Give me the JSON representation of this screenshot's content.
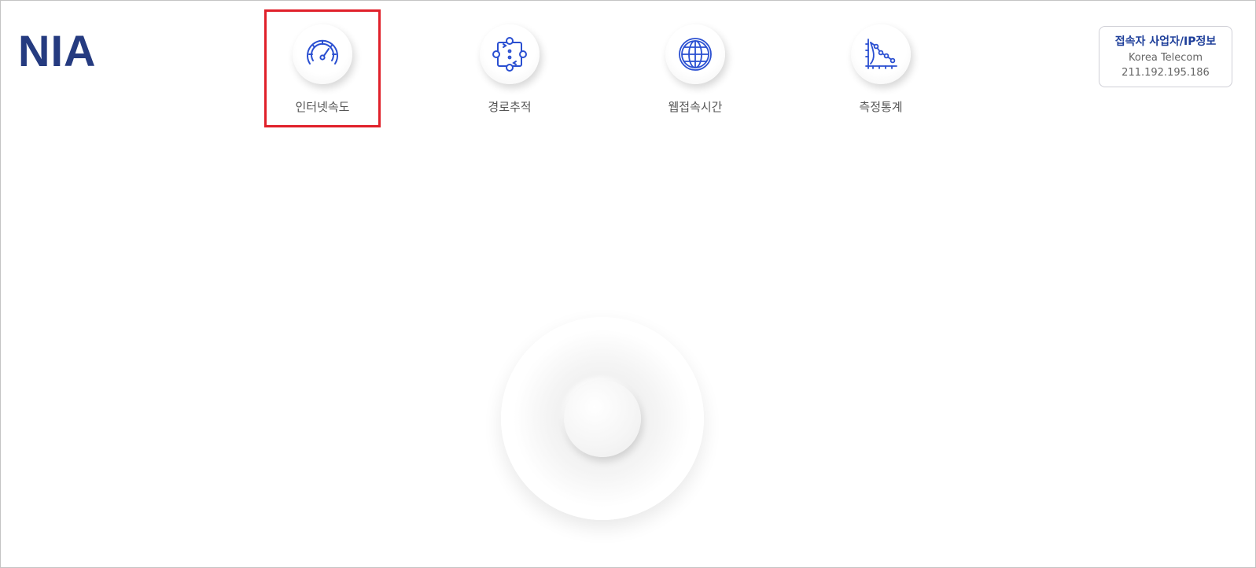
{
  "logo": {
    "text": "NIA"
  },
  "nav": {
    "items": [
      {
        "label": "인터넷속도",
        "icon": "speedometer-icon",
        "selected": true
      },
      {
        "label": "경로추적",
        "icon": "route-trace-icon",
        "selected": false
      },
      {
        "label": "웹접속시간",
        "icon": "globe-icon",
        "selected": false
      },
      {
        "label": "측정통계",
        "icon": "statistics-chart-icon",
        "selected": false
      }
    ]
  },
  "connection_info": {
    "title": "접속자 사업자/IP정보",
    "isp": "Korea Telecom",
    "ip": "211.192.195.186"
  },
  "colors": {
    "brand": "#253b80",
    "accent_blue": "#1e3f9a",
    "icon_blue": "#2a4fd1",
    "selection_red": "#e0202a"
  }
}
